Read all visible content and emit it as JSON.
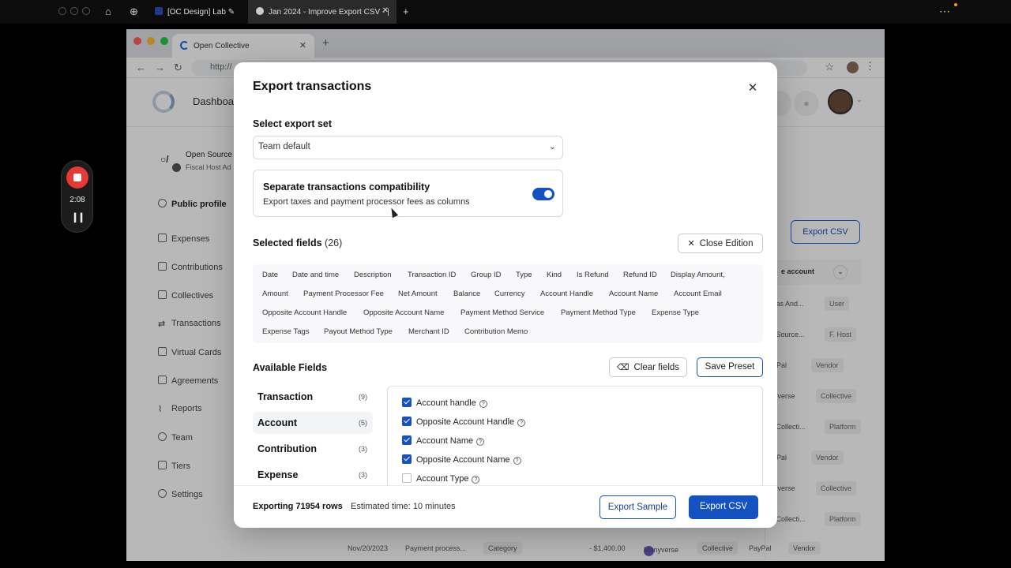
{
  "outer": {
    "tab1": "[OC Design] Lab",
    "tab2": "Jan 2024 - Improve Export CSV - |",
    "new_tab": "+",
    "more": "⋯"
  },
  "recorder": {
    "time": "2:08"
  },
  "window": {
    "tab_title": "Open Collective",
    "url": "http://"
  },
  "app": {
    "header_title": "Dashboa",
    "account_name": "Open Source",
    "account_sub": "Fiscal Host Ad",
    "sidebar": [
      "Public profile",
      "Expenses",
      "Contributions",
      "Collectives",
      "Transactions",
      "Virtual Cards",
      "Agreements",
      "Reports",
      "Team",
      "Tiers",
      "Settings"
    ],
    "export_btn": "Export CSV",
    "col_head": "e account",
    "rows": [
      {
        "name": "mas And...",
        "tag": "User"
      },
      {
        "name": "n Source...",
        "tag": "F. Host"
      },
      {
        "name": "Pal",
        "tag": "Vendor"
      },
      {
        "name": "nyverse",
        "tag": "Collective"
      },
      {
        "name": "n Collecti...",
        "tag": "Platform"
      },
      {
        "name": "Pal",
        "tag": "Vendor"
      },
      {
        "name": "nyverse",
        "tag": "Collective"
      },
      {
        "name": "n Collecti...",
        "tag": "Platform"
      }
    ],
    "bottom_row": {
      "date": "Nov/20/2023",
      "desc": "Payment process...",
      "category": "Category",
      "amount": "- $1,400.00",
      "account": "Manyverse",
      "account_tag": "Collective",
      "opp": "PayPal",
      "opp_tag": "Vendor"
    }
  },
  "modal": {
    "title": "Export transactions",
    "select_label": "Select export set",
    "select_value": "Team default",
    "compat_title": "Separate transactions compatibility",
    "compat_desc": "Export taxes and payment processor fees as columns",
    "compat_on": true,
    "selected_label": "Selected fields",
    "selected_count": "(26)",
    "close_edition": "Close Edition",
    "fields": [
      "Date",
      "Date and time",
      "Description",
      "Transaction ID",
      "Group ID",
      "Type",
      "Kind",
      "Is Refund",
      "Refund ID",
      "Display Amount,",
      "Amount",
      "Payment Processor Fee",
      "Net Amount",
      "Balance",
      "Currency",
      "Account Handle",
      "Account Name",
      "Account Email",
      "Opposite Account Handle",
      "Opposite Account Name",
      "Payment Method Service",
      "Payment Method Type",
      "Expense Type",
      "Expense Tags",
      "Payout Method Type",
      "Merchant ID",
      "Contribution Memo"
    ],
    "available_label": "Available Fields",
    "clear_fields": "Clear fields",
    "save_preset": "Save Preset",
    "tabs": [
      {
        "label": "Transaction",
        "count": "(9)"
      },
      {
        "label": "Account",
        "count": "(5)"
      },
      {
        "label": "Contribution",
        "count": "(3)"
      },
      {
        "label": "Expense",
        "count": "(3)"
      }
    ],
    "checks": [
      {
        "label": "Account handle",
        "checked": true
      },
      {
        "label": "Opposite Account Handle",
        "checked": true
      },
      {
        "label": "Account Name",
        "checked": true
      },
      {
        "label": "Opposite Account Name",
        "checked": true
      },
      {
        "label": "Account Type",
        "checked": false
      }
    ],
    "export_rows": "Exporting 71954 rows",
    "estimate": "Estimated time: 10 minutes",
    "export_sample": "Export Sample",
    "export_csv": "Export CSV"
  },
  "colors": {
    "accent": "#1452c2",
    "record": "#e53935"
  }
}
